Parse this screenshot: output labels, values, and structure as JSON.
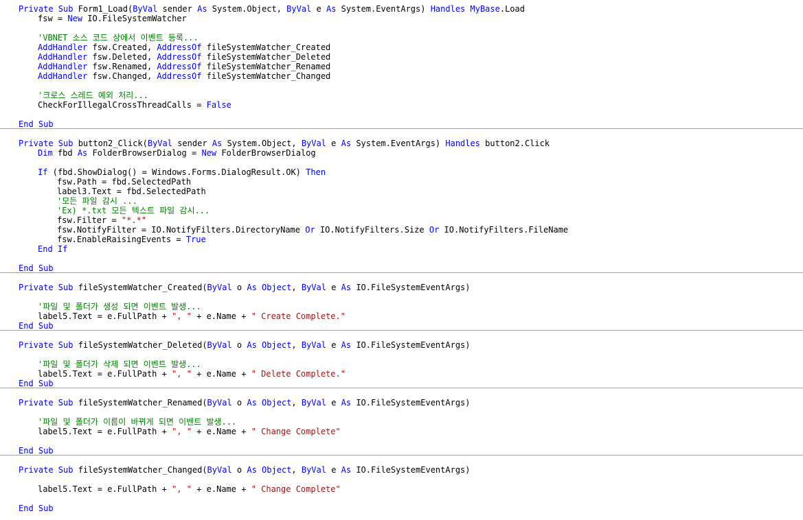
{
  "colors": {
    "keyword": "#0000ff",
    "comment": "#008000",
    "string": "#a31515",
    "text": "#000000",
    "separator": "#a0a0a0"
  },
  "lines": [
    {
      "indent": 0,
      "tokens": [
        [
          "k",
          "Private Sub "
        ],
        [
          "t",
          "Form1_Load("
        ],
        [
          "k",
          "ByVal"
        ],
        [
          "t",
          " sender "
        ],
        [
          "k",
          "As"
        ],
        [
          "t",
          " System.Object, "
        ],
        [
          "k",
          "ByVal"
        ],
        [
          "t",
          " e "
        ],
        [
          "k",
          "As"
        ],
        [
          "t",
          " System.EventArgs) "
        ],
        [
          "k",
          "Handles MyBase"
        ],
        [
          "t",
          ".Load"
        ]
      ]
    },
    {
      "indent": 4,
      "tokens": [
        [
          "t",
          "fsw = "
        ],
        [
          "k",
          "New"
        ],
        [
          "t",
          " IO.FileSystemWatcher"
        ]
      ]
    },
    {
      "indent": 0,
      "tokens": []
    },
    {
      "indent": 4,
      "tokens": [
        [
          "c",
          "'VBNET 소스 코드 상에서 이벤트 등록..."
        ]
      ]
    },
    {
      "indent": 4,
      "tokens": [
        [
          "k",
          "AddHandler"
        ],
        [
          "t",
          " fsw.Created, "
        ],
        [
          "k",
          "AddressOf"
        ],
        [
          "t",
          " fileSystemWatcher_Created"
        ]
      ]
    },
    {
      "indent": 4,
      "tokens": [
        [
          "k",
          "AddHandler"
        ],
        [
          "t",
          " fsw.Deleted, "
        ],
        [
          "k",
          "AddressOf"
        ],
        [
          "t",
          " fileSystemWatcher_Deleted"
        ]
      ]
    },
    {
      "indent": 4,
      "tokens": [
        [
          "k",
          "AddHandler"
        ],
        [
          "t",
          " fsw.Renamed, "
        ],
        [
          "k",
          "AddressOf"
        ],
        [
          "t",
          " fileSystemWatcher_Renamed"
        ]
      ]
    },
    {
      "indent": 4,
      "tokens": [
        [
          "k",
          "AddHandler"
        ],
        [
          "t",
          " fsw.Changed, "
        ],
        [
          "k",
          "AddressOf"
        ],
        [
          "t",
          " fileSystemWatcher_Changed"
        ]
      ]
    },
    {
      "indent": 0,
      "tokens": []
    },
    {
      "indent": 4,
      "tokens": [
        [
          "c",
          "'크로스 스레드 예외 처리..."
        ]
      ]
    },
    {
      "indent": 4,
      "tokens": [
        [
          "t",
          "CheckForIllegalCrossThreadCalls = "
        ],
        [
          "k",
          "False"
        ]
      ]
    },
    {
      "indent": 0,
      "tokens": []
    },
    {
      "indent": 0,
      "tokens": [
        [
          "k",
          "End Sub"
        ]
      ]
    },
    {
      "indent": 0,
      "tokens": []
    },
    {
      "indent": 0,
      "tokens": [
        [
          "k",
          "Private Sub "
        ],
        [
          "t",
          "button2_Click("
        ],
        [
          "k",
          "ByVal"
        ],
        [
          "t",
          " sender "
        ],
        [
          "k",
          "As"
        ],
        [
          "t",
          " System.Object, "
        ],
        [
          "k",
          "ByVal"
        ],
        [
          "t",
          " e "
        ],
        [
          "k",
          "As"
        ],
        [
          "t",
          " System.EventArgs) "
        ],
        [
          "k",
          "Handles"
        ],
        [
          "t",
          " button2.Click"
        ]
      ]
    },
    {
      "indent": 4,
      "tokens": [
        [
          "k",
          "Dim"
        ],
        [
          "t",
          " fbd "
        ],
        [
          "k",
          "As"
        ],
        [
          "t",
          " FolderBrowserDialog = "
        ],
        [
          "k",
          "New"
        ],
        [
          "t",
          " FolderBrowserDialog"
        ]
      ]
    },
    {
      "indent": 0,
      "tokens": []
    },
    {
      "indent": 4,
      "tokens": [
        [
          "k",
          "If"
        ],
        [
          "t",
          " (fbd.ShowDialog() = Windows.Forms.DialogResult.OK) "
        ],
        [
          "k",
          "Then"
        ]
      ]
    },
    {
      "indent": 8,
      "tokens": [
        [
          "t",
          "fsw.Path = fbd.SelectedPath"
        ]
      ]
    },
    {
      "indent": 8,
      "tokens": [
        [
          "t",
          "label3.Text = fbd.SelectedPath"
        ]
      ]
    },
    {
      "indent": 8,
      "tokens": [
        [
          "c",
          "'모든 파일 감시 ..."
        ]
      ]
    },
    {
      "indent": 8,
      "tokens": [
        [
          "c",
          "'Ex) *.txt 모든 텍스트 파일 감시..."
        ]
      ]
    },
    {
      "indent": 8,
      "tokens": [
        [
          "t",
          "fsw.Filter = "
        ],
        [
          "s",
          "\"*.*\""
        ]
      ]
    },
    {
      "indent": 8,
      "tokens": [
        [
          "t",
          "fsw.NotifyFilter = IO.NotifyFilters.DirectoryName "
        ],
        [
          "k",
          "Or"
        ],
        [
          "t",
          " IO.NotifyFilters.Size "
        ],
        [
          "k",
          "Or"
        ],
        [
          "t",
          " IO.NotifyFilters.FileName"
        ]
      ]
    },
    {
      "indent": 8,
      "tokens": [
        [
          "t",
          "fsw.EnableRaisingEvents = "
        ],
        [
          "k",
          "True"
        ]
      ]
    },
    {
      "indent": 4,
      "tokens": [
        [
          "k",
          "End If"
        ]
      ]
    },
    {
      "indent": 0,
      "tokens": []
    },
    {
      "indent": 0,
      "tokens": [
        [
          "k",
          "End Sub"
        ]
      ]
    },
    {
      "indent": 0,
      "tokens": []
    },
    {
      "indent": 0,
      "tokens": [
        [
          "k",
          "Private Sub "
        ],
        [
          "t",
          "fileSystemWatcher_Created("
        ],
        [
          "k",
          "ByVal"
        ],
        [
          "t",
          " o "
        ],
        [
          "k",
          "As Object"
        ],
        [
          "t",
          ", "
        ],
        [
          "k",
          "ByVal"
        ],
        [
          "t",
          " e "
        ],
        [
          "k",
          "As"
        ],
        [
          "t",
          " IO.FileSystemEventArgs)"
        ]
      ]
    },
    {
      "indent": 0,
      "tokens": []
    },
    {
      "indent": 4,
      "tokens": [
        [
          "c",
          "'파일 및 폴더가 생성 되면 이벤트 발생..."
        ]
      ]
    },
    {
      "indent": 4,
      "tokens": [
        [
          "t",
          "label5.Text = e.FullPath + "
        ],
        [
          "s",
          "\", \""
        ],
        [
          "t",
          " + e.Name + "
        ],
        [
          "s",
          "\" Create Complete.\""
        ]
      ]
    },
    {
      "indent": 0,
      "tokens": [
        [
          "k",
          "End Sub"
        ]
      ]
    },
    {
      "indent": 0,
      "tokens": []
    },
    {
      "indent": 0,
      "tokens": [
        [
          "k",
          "Private Sub "
        ],
        [
          "t",
          "fileSystemWatcher_Deleted("
        ],
        [
          "k",
          "ByVal"
        ],
        [
          "t",
          " o "
        ],
        [
          "k",
          "As Object"
        ],
        [
          "t",
          ", "
        ],
        [
          "k",
          "ByVal"
        ],
        [
          "t",
          " e "
        ],
        [
          "k",
          "As"
        ],
        [
          "t",
          " IO.FileSystemEventArgs)"
        ]
      ]
    },
    {
      "indent": 0,
      "tokens": []
    },
    {
      "indent": 4,
      "tokens": [
        [
          "c",
          "'파일 및 폴더가 삭제 되면 이벤트 발생..."
        ]
      ]
    },
    {
      "indent": 4,
      "tokens": [
        [
          "t",
          "label5.Text = e.FullPath + "
        ],
        [
          "s",
          "\", \""
        ],
        [
          "t",
          " + e.Name + "
        ],
        [
          "s",
          "\" Delete Complete.\""
        ]
      ]
    },
    {
      "indent": 0,
      "tokens": [
        [
          "k",
          "End Sub"
        ]
      ]
    },
    {
      "indent": 0,
      "tokens": []
    },
    {
      "indent": 0,
      "tokens": [
        [
          "k",
          "Private Sub "
        ],
        [
          "t",
          "fileSystemWatcher_Renamed("
        ],
        [
          "k",
          "ByVal"
        ],
        [
          "t",
          " o "
        ],
        [
          "k",
          "As Object"
        ],
        [
          "t",
          ", "
        ],
        [
          "k",
          "ByVal"
        ],
        [
          "t",
          " e "
        ],
        [
          "k",
          "As"
        ],
        [
          "t",
          " IO.FileSystemEventArgs)"
        ]
      ]
    },
    {
      "indent": 0,
      "tokens": []
    },
    {
      "indent": 4,
      "tokens": [
        [
          "c",
          "'파일 및 폴더가 이름이 바뀌게 되면 이벤트 발생..."
        ]
      ]
    },
    {
      "indent": 4,
      "tokens": [
        [
          "t",
          "label5.Text = e.FullPath + "
        ],
        [
          "s",
          "\", \""
        ],
        [
          "t",
          " + e.Name + "
        ],
        [
          "s",
          "\" Change Complete\""
        ]
      ]
    },
    {
      "indent": 0,
      "tokens": []
    },
    {
      "indent": 0,
      "tokens": [
        [
          "k",
          "End Sub"
        ]
      ]
    },
    {
      "indent": 0,
      "tokens": []
    },
    {
      "indent": 0,
      "tokens": [
        [
          "k",
          "Private Sub "
        ],
        [
          "t",
          "fileSystemWatcher_Changed("
        ],
        [
          "k",
          "ByVal"
        ],
        [
          "t",
          " o "
        ],
        [
          "k",
          "As Object"
        ],
        [
          "t",
          ", "
        ],
        [
          "k",
          "ByVal"
        ],
        [
          "t",
          " e "
        ],
        [
          "k",
          "As"
        ],
        [
          "t",
          " IO.FileSystemEventArgs)"
        ]
      ]
    },
    {
      "indent": 0,
      "tokens": []
    },
    {
      "indent": 4,
      "tokens": [
        [
          "t",
          "label5.Text = e.FullPath + "
        ],
        [
          "s",
          "\", \""
        ],
        [
          "t",
          " + e.Name + "
        ],
        [
          "s",
          "\" Change Complete\""
        ]
      ]
    },
    {
      "indent": 0,
      "tokens": []
    },
    {
      "indent": 0,
      "tokens": [
        [
          "k",
          "End Sub"
        ]
      ]
    }
  ]
}
